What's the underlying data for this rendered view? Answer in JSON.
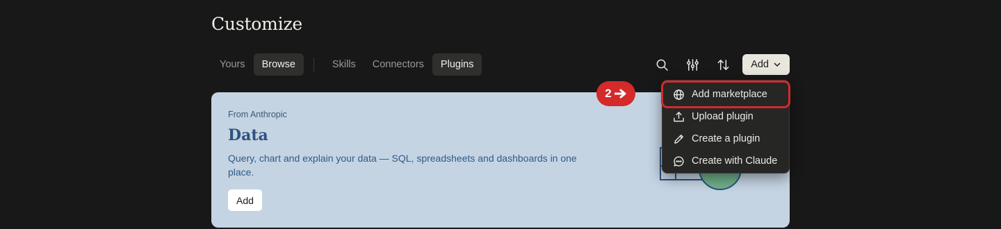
{
  "page": {
    "title": "Customize"
  },
  "tabs": {
    "view": [
      {
        "label": "Yours",
        "active": false
      },
      {
        "label": "Browse",
        "active": true
      }
    ],
    "category": [
      {
        "label": "Skills",
        "active": false
      },
      {
        "label": "Connectors",
        "active": false
      },
      {
        "label": "Plugins",
        "active": true
      }
    ]
  },
  "toolbar": {
    "icons": [
      "search-icon",
      "filter-sliders-icon",
      "sort-icon"
    ],
    "add_label": "Add"
  },
  "card": {
    "source": "From Anthropic",
    "name": "Data",
    "description": "Query, chart and explain your data — SQL, spreadsheets and dashboards in one place.",
    "add_label": "Add",
    "background": "#c5d4e3"
  },
  "annotation": {
    "step": "2"
  },
  "dropdown": {
    "items": [
      {
        "label": "Add marketplace",
        "icon": "globe-icon",
        "highlighted": true
      },
      {
        "label": "Upload plugin",
        "icon": "upload-icon",
        "highlighted": false
      },
      {
        "label": "Create a plugin",
        "icon": "pencil-icon",
        "highlighted": false
      },
      {
        "label": "Create with Claude",
        "icon": "chat-bubble-icon",
        "highlighted": false
      }
    ]
  },
  "colors": {
    "background": "#181818",
    "accent_red": "#d42a2a",
    "add_button": "#e9e6de"
  }
}
